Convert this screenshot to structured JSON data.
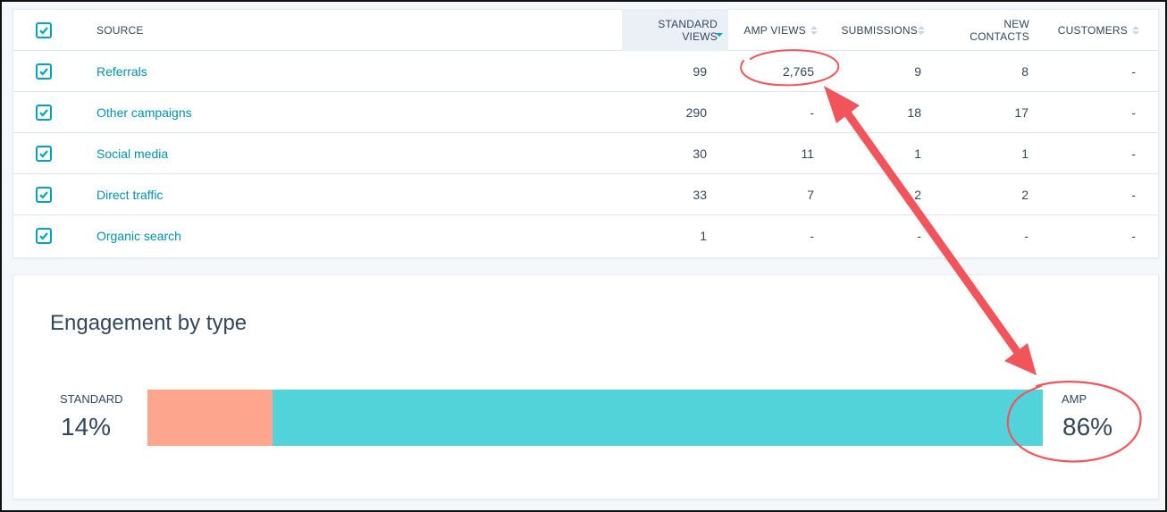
{
  "table": {
    "header": {
      "source": "SOURCE",
      "standard_views": [
        "STANDARD",
        "VIEWS"
      ],
      "amp_views": "AMP VIEWS",
      "submissions": "SUBMISSIONS",
      "new_contacts": [
        "NEW",
        "CONTACTS"
      ],
      "customers": "CUSTOMERS"
    },
    "sorted_column": "standard_views",
    "rows": [
      {
        "source": "Referrals",
        "standard_views": "99",
        "amp_views": "2,765",
        "submissions": "9",
        "new_contacts": "8",
        "customers": "-"
      },
      {
        "source": "Other campaigns",
        "standard_views": "290",
        "amp_views": "-",
        "submissions": "18",
        "new_contacts": "17",
        "customers": "-"
      },
      {
        "source": "Social media",
        "standard_views": "30",
        "amp_views": "11",
        "submissions": "1",
        "new_contacts": "1",
        "customers": "-"
      },
      {
        "source": "Direct traffic",
        "standard_views": "33",
        "amp_views": "7",
        "submissions": "2",
        "new_contacts": "2",
        "customers": "-"
      },
      {
        "source": "Organic search",
        "standard_views": "1",
        "amp_views": "-",
        "submissions": "-",
        "new_contacts": "-",
        "customers": "-"
      }
    ]
  },
  "engagement": {
    "title": "Engagement by type",
    "standard": {
      "label": "STANDARD",
      "percent_text": "14%",
      "fraction": 0.14
    },
    "amp": {
      "label": "AMP",
      "percent_text": "86%",
      "fraction": 0.86
    }
  },
  "colors": {
    "accent": "#00a4bd",
    "link": "#0091ae",
    "standard_bar": "#fea58e",
    "amp_bar": "#51d3d9",
    "annotation": "#f2545b"
  }
}
